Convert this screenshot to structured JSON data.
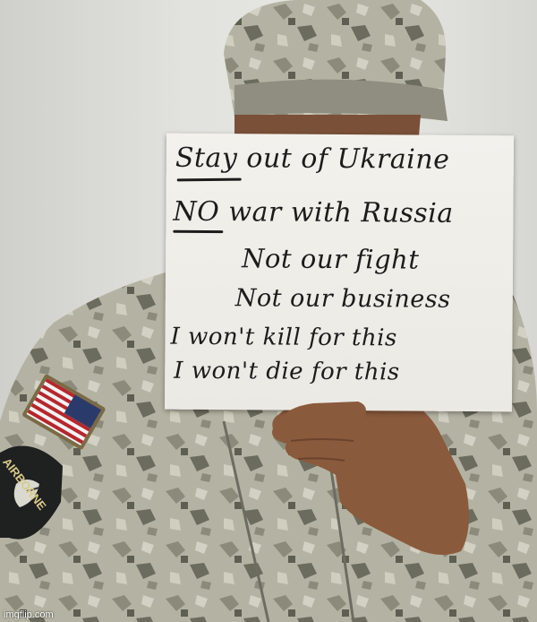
{
  "image": {
    "description_text": [],
    "sign": {
      "lines": [
        "Stay out of Ukraine",
        "NO war with Russia",
        "Not our fight",
        "Not our business",
        "I won't kill for this",
        "I won't die for this"
      ]
    },
    "patch_text": "AIRBORNE",
    "watermark": "imgflip.com",
    "colors": {
      "wall": "#e2e2de",
      "camo_light": "#b9b8a8",
      "camo_mid": "#8d8c7c",
      "camo_dark": "#5e5e52",
      "skin": "#8a5a3c",
      "sign_paper": "#efede7",
      "ink": "#1c1c1c"
    }
  }
}
